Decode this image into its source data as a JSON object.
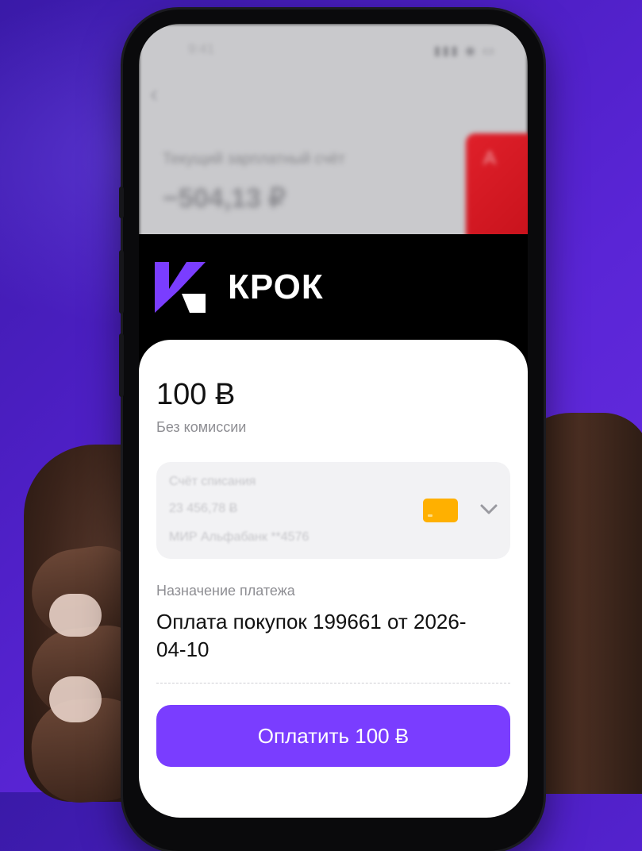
{
  "status_bar": {
    "time": "9:41",
    "icons": "▮▮▮ ◉ ▭"
  },
  "background_app": {
    "back_icon": "‹",
    "account_title": "Текущий зарплатный счёт",
    "account_sum": "−504,13 ₽",
    "card_mark": "A"
  },
  "brand": {
    "name": "КРОК",
    "logo_color": "#7a3dff"
  },
  "payment": {
    "amount": "100 Ƀ",
    "commission": "Без комиссии",
    "account": {
      "label": "Счёт списания",
      "balance": "23 456,78 Ƀ",
      "card": "МИР Альфабанк **4576",
      "card_color": "#ffb000"
    },
    "purpose_label": "Назначение платежа",
    "purpose_value": "Оплата покупок 199661 от 2026-04-10",
    "button_label": "Оплатить 100 Ƀ",
    "button_color": "#7a3dff"
  }
}
